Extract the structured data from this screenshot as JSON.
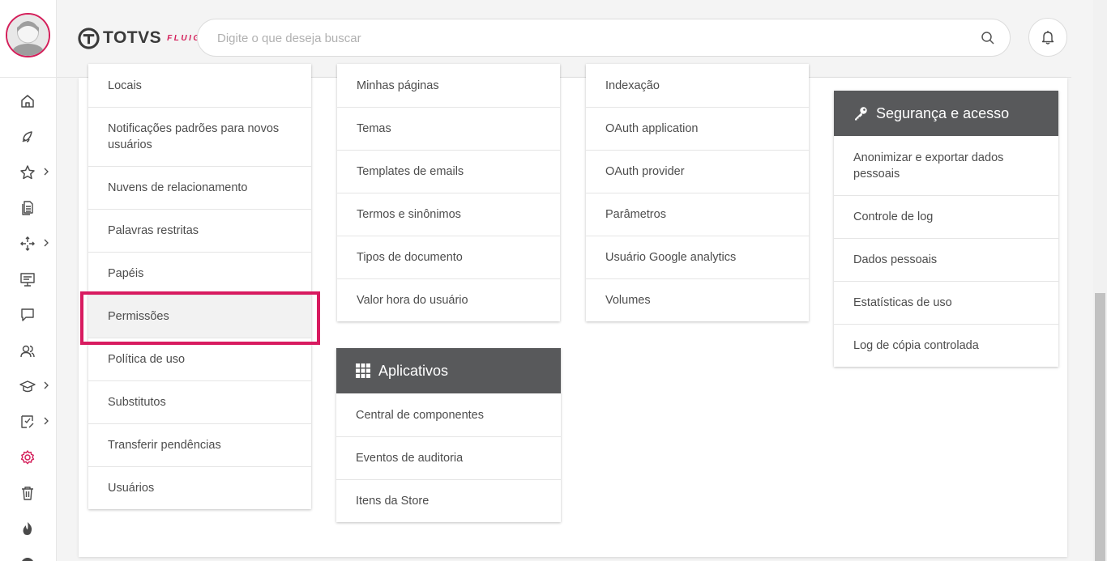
{
  "header": {
    "logo_text": "TOTVS",
    "logo_sub": "FLUIG",
    "search_placeholder": "Digite o que deseja buscar"
  },
  "colors": {
    "accent": "#d41f5a",
    "card_header": "#58595b",
    "highlight": "#d81b60"
  },
  "sidebar": {
    "items": [
      {
        "icon": "home-icon"
      },
      {
        "icon": "rocket-icon"
      },
      {
        "icon": "star-icon",
        "chevron": true
      },
      {
        "icon": "documents-icon"
      },
      {
        "icon": "workflow-icon",
        "chevron": true
      },
      {
        "icon": "presentation-icon"
      },
      {
        "icon": "chat-icon"
      },
      {
        "icon": "users-icon"
      },
      {
        "icon": "graduation-cap-icon",
        "chevron": true
      },
      {
        "icon": "checklist-icon",
        "chevron": true
      },
      {
        "icon": "gear-icon",
        "active": true
      },
      {
        "icon": "trash-icon"
      },
      {
        "icon": "fire-icon"
      }
    ]
  },
  "columns": {
    "col1": {
      "items": [
        "Locais",
        "Notificações padrões para novos usuários",
        "Nuvens de relacionamento",
        "Palavras restritas",
        "Papéis",
        "Permissões",
        "Política de uso",
        "Substitutos",
        "Transferir pendências",
        "Usuários"
      ]
    },
    "col2": {
      "items": [
        "Minhas páginas",
        "Temas",
        "Templates de emails",
        "Termos e sinônimos",
        "Tipos de documento",
        "Valor hora do usuário"
      ]
    },
    "col2b": {
      "title": "Aplicativos",
      "icon": "grid-icon",
      "items": [
        "Central de componentes",
        "Eventos de auditoria",
        "Itens da Store"
      ]
    },
    "col3": {
      "items": [
        "Indexação",
        "OAuth application",
        "OAuth provider",
        "Parâmetros",
        "Usuário Google analytics",
        "Volumes"
      ]
    },
    "col4": {
      "title": "Segurança e acesso",
      "icon": "key-icon",
      "items": [
        "Anonimizar e exportar dados pessoais",
        "Controle de log",
        "Dados pessoais",
        "Estatísticas de uso",
        "Log de cópia controlada"
      ]
    }
  }
}
